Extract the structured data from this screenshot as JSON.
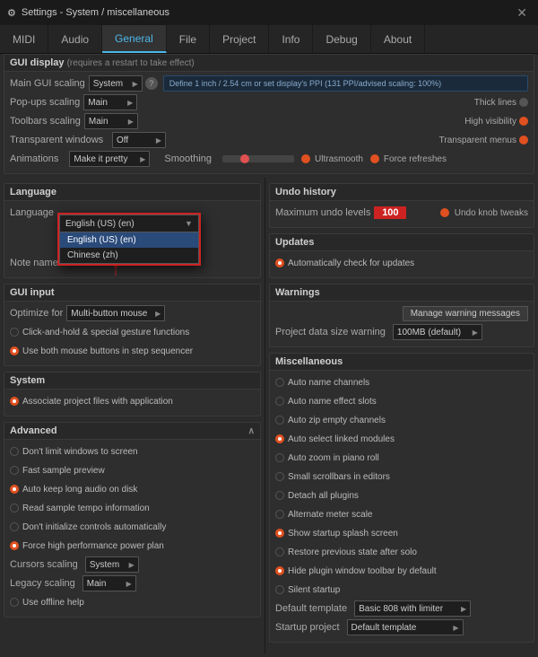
{
  "titleBar": {
    "title": "Settings - System / miscellaneous",
    "closeLabel": "✕"
  },
  "tabs": [
    {
      "label": "MIDI",
      "active": false
    },
    {
      "label": "Audio",
      "active": false
    },
    {
      "label": "General",
      "active": true
    },
    {
      "label": "File",
      "active": false
    },
    {
      "label": "Project",
      "active": false
    },
    {
      "label": "Info",
      "active": false
    },
    {
      "label": "Debug",
      "active": false
    },
    {
      "label": "About",
      "active": false
    }
  ],
  "guiDisplay": {
    "header": "GUI display",
    "subtitle": "(requires a restart to take effect)",
    "mainGuiScaling": {
      "label": "Main GUI scaling",
      "value": "System"
    },
    "popUpsScaling": {
      "label": "Pop-ups scaling",
      "value": "Main"
    },
    "toolbarsScaling": {
      "label": "Toolbars scaling",
      "value": "Main"
    },
    "transparentWindows": {
      "label": "Transparent windows",
      "value": "Off"
    },
    "animations": {
      "label": "Animations",
      "value": "Make it pretty"
    },
    "smoothing": {
      "label": "Smoothing"
    },
    "ultrasmooth": "Ultrasmooth",
    "forceRefreshes": "Force refreshes",
    "infoBox": "Define 1 inch / 2.54 cm or set display's PPI\n(131 PPI/advised scaling: 100%)",
    "thickLines": "Thick lines",
    "highVisibility": "High visibility",
    "transparentMenus": "Transparent menus"
  },
  "language": {
    "header": "Language",
    "languageLabel": "Language",
    "noteNamesLabel": "Note names",
    "dropdown": {
      "current": "English (US) (en)",
      "options": [
        "English (US) (en)",
        "Chinese (zh)"
      ]
    }
  },
  "guiInput": {
    "header": "GUI input",
    "optimizeFor": {
      "label": "Optimize for",
      "value": "Multi-button mouse"
    },
    "options": [
      {
        "text": "Click-and-hold & special gesture functions",
        "active": false
      },
      {
        "text": "Use both mouse buttons in step sequencer",
        "active": true
      }
    ]
  },
  "system": {
    "header": "System",
    "options": [
      {
        "text": "Associate project files with application",
        "active": true
      }
    ]
  },
  "advanced": {
    "header": "Advanced",
    "collapsed": false,
    "options": [
      {
        "text": "Don't limit windows to screen",
        "active": false
      },
      {
        "text": "Fast sample preview",
        "active": false
      },
      {
        "text": "Auto keep long audio on disk",
        "active": true
      },
      {
        "text": "Read sample tempo information",
        "active": false
      },
      {
        "text": "Don't initialize controls automatically",
        "active": false
      },
      {
        "text": "Force high performance power plan",
        "active": true
      }
    ],
    "cursorsScaling": {
      "label": "Cursors scaling",
      "value": "System"
    },
    "legacyScaling": {
      "label": "Legacy scaling",
      "value": "Main"
    },
    "useOfflineHelp": {
      "text": "Use offline help",
      "active": false
    }
  },
  "undoHistory": {
    "header": "Undo history",
    "maxUndoLevels": {
      "label": "Maximum undo levels",
      "value": "100"
    },
    "undoKnobTweaks": "Undo knob tweaks"
  },
  "updates": {
    "header": "Updates",
    "autoCheck": {
      "text": "Automatically check for updates",
      "active": true
    }
  },
  "warnings": {
    "header": "Warnings",
    "manageBtn": "Manage warning messages",
    "projectDataSize": {
      "label": "Project data size warning",
      "value": "100MB (default)"
    }
  },
  "miscellaneous": {
    "header": "Miscellaneous",
    "options": [
      {
        "text": "Auto name channels",
        "active": false
      },
      {
        "text": "Auto name effect slots",
        "active": false
      },
      {
        "text": "Auto zip empty channels",
        "active": false
      },
      {
        "text": "Auto select linked modules",
        "active": true
      },
      {
        "text": "Auto zoom in piano roll",
        "active": false
      },
      {
        "text": "Small scrollbars in editors",
        "active": false
      },
      {
        "text": "Detach all plugins",
        "active": false
      },
      {
        "text": "Alternate meter scale",
        "active": false
      },
      {
        "text": "Show startup splash screen",
        "active": true
      },
      {
        "text": "Restore previous state after solo",
        "active": false
      },
      {
        "text": "Hide plugin window toolbar by default",
        "active": true
      },
      {
        "text": "Silent startup",
        "active": false
      }
    ],
    "defaultTemplate": {
      "label": "Default template",
      "value": "Basic 808 with limiter"
    },
    "startupProject": {
      "label": "Startup project",
      "value": "Default template"
    }
  }
}
